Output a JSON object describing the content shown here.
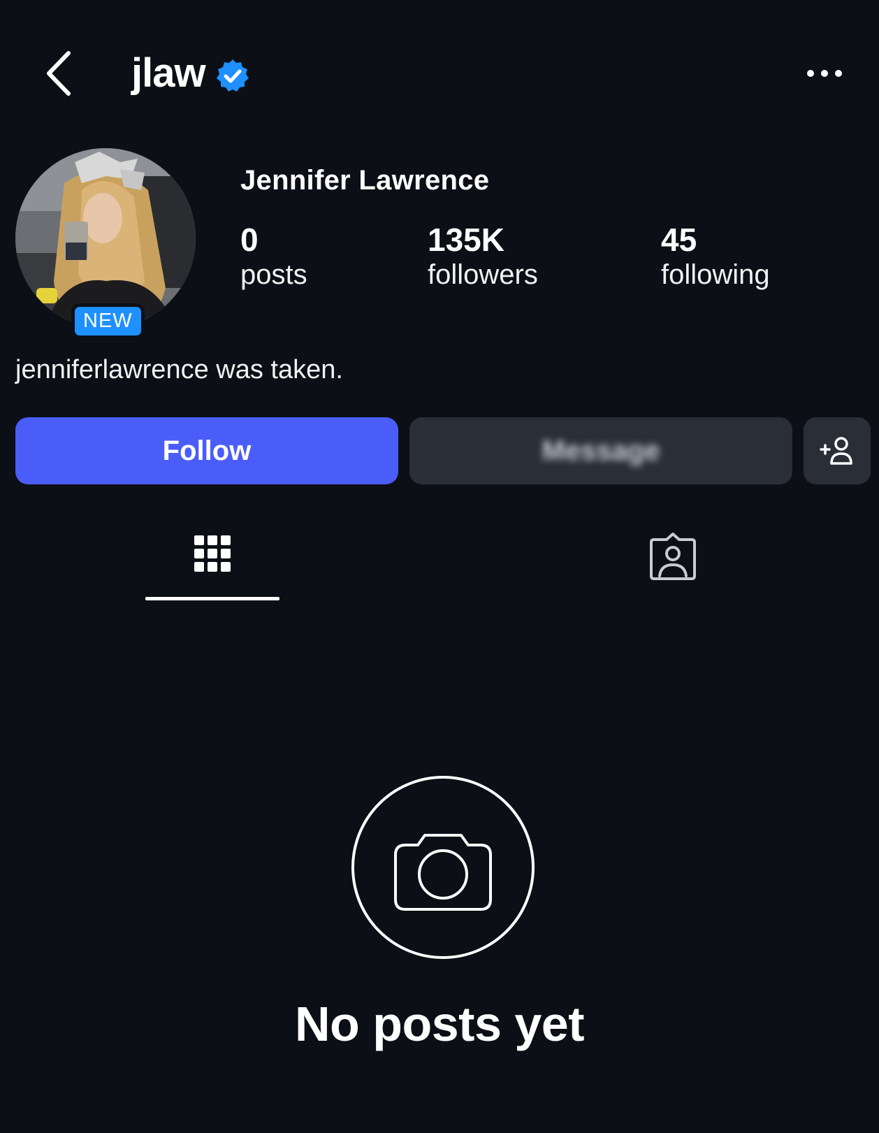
{
  "header": {
    "username": "jlaw",
    "verified": true,
    "back_icon": "chevron-left-icon",
    "more_icon": "more-horizontal-icon"
  },
  "profile": {
    "full_name": "Jennifer Lawrence",
    "avatar_badge": "NEW",
    "stats": {
      "posts": {
        "value": "0",
        "label": "posts"
      },
      "followers": {
        "value": "135K",
        "label": "followers"
      },
      "following": {
        "value": "45",
        "label": "following"
      }
    },
    "bio": "jenniferlawrence was taken."
  },
  "actions": {
    "follow_label": "Follow",
    "message_label": "Message",
    "suggest_icon": "add-person-icon"
  },
  "tabs": [
    {
      "name": "posts-grid",
      "icon": "grid-icon",
      "active": true
    },
    {
      "name": "tagged",
      "icon": "tagged-person-icon",
      "active": false
    }
  ],
  "empty_state": {
    "icon": "camera-icon",
    "text": "No posts yet"
  },
  "colors": {
    "background": "#0c0f16",
    "follow_button": "#4a5df9",
    "secondary_button": "#2a2f37",
    "verified_badge": "#1e90ff",
    "new_badge": "#1e90ff"
  }
}
